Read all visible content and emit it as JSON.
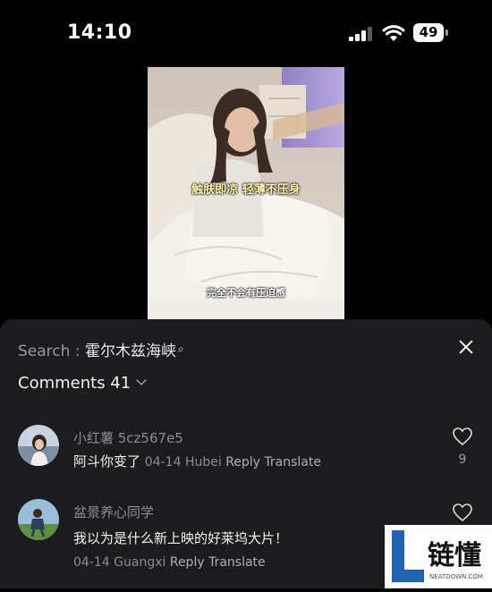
{
  "status": {
    "time": "14:10",
    "battery": "49"
  },
  "video": {
    "caption_top": "触肤即凉 轻薄不压身",
    "caption_bottom": "完全不会有压迫感"
  },
  "sheet": {
    "search_label": "Search : ",
    "search_query": "霍尔木兹海峡",
    "comments_title": "Comments 41",
    "comments": [
      {
        "user": "小红薯 5cz567e5",
        "text": "阿斗你变了",
        "date": "04-14",
        "location": "Hubei",
        "reply": "Reply",
        "translate": "Translate",
        "likes": "9"
      },
      {
        "user": "盆景养心同学",
        "text": "我以为是什么新上映的好莱坞大片！",
        "date": "04-14",
        "location": "Guangxi",
        "reply": "Reply",
        "translate": "Translate",
        "likes": ""
      }
    ]
  },
  "watermark": {
    "text": "链懂",
    "sub": "NEATDOWN.COM",
    "letter": "L"
  },
  "icons": [
    "signal-icon",
    "wifi-icon",
    "battery-icon",
    "close-icon",
    "chevron-down-icon",
    "heart-icon"
  ]
}
